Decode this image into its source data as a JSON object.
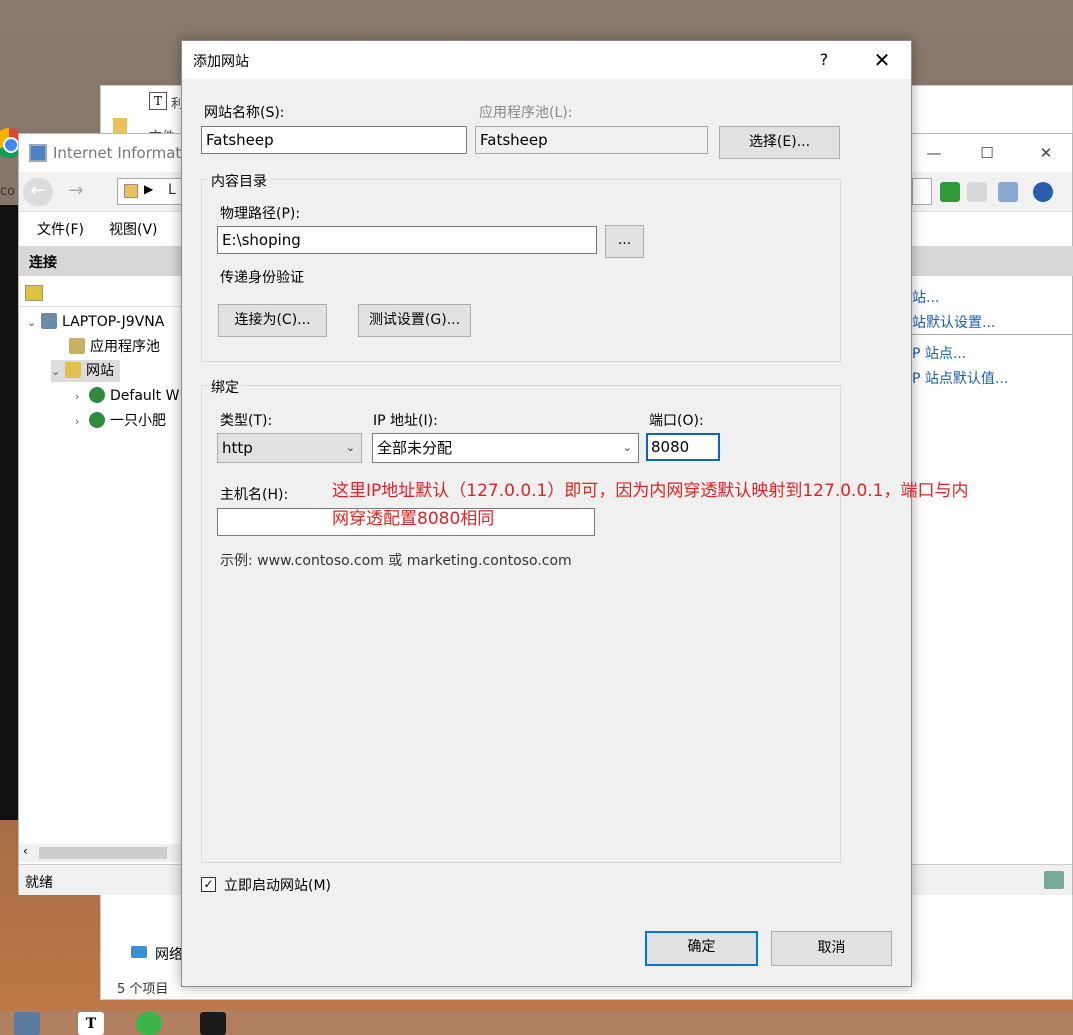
{
  "explorer": {
    "tab_label": "T",
    "tab_text": "利",
    "file_text": "文件",
    "network_label": "网络",
    "item_count": "5 个项目"
  },
  "left": {
    "partial_text": "co"
  },
  "iis": {
    "title": "Internet Informati",
    "address_text": "L",
    "minimize_glyph": "—",
    "maximize_glyph": "☐",
    "close_glyph": "✕",
    "back_glyph": "←",
    "forward_glyph": "→",
    "crumb_glyph": "▶",
    "menu": {
      "file": "文件(F)",
      "view": "视图(V)"
    },
    "connections_header": "连接",
    "tree": {
      "server": "LAPTOP-J9VNA",
      "app_pools": "应用程序池",
      "sites": "网站",
      "site1": "Default W",
      "site2": "一只小肥"
    },
    "actions": [
      "站...",
      "站默认设置...",
      "P 站点...",
      "P 站点默认值..."
    ],
    "status": "就绪"
  },
  "dialog": {
    "title": "添加网站",
    "help": "?",
    "close": "✕",
    "site_name_label": "网站名称(S):",
    "site_name_value": "Fatsheep",
    "app_pool_label": "应用程序池(L):",
    "app_pool_value": "Fatsheep",
    "select_button": "选择(E)...",
    "content_dir_title": "内容目录",
    "physical_path_label": "物理路径(P):",
    "physical_path_value": "E:\\shoping",
    "browse_button": "...",
    "pass_through_label": "传递身份验证",
    "connect_as_button": "连接为(C)...",
    "test_settings_button": "测试设置(G)...",
    "binding_title": "绑定",
    "type_label": "类型(T):",
    "type_value": "http",
    "ip_label": "IP 地址(I):",
    "ip_value": "全部未分配",
    "port_label": "端口(O):",
    "port_value": "8080",
    "hostname_label": "主机名(H):",
    "hostname_value": "",
    "example_text": "示例: www.contoso.com 或 marketing.contoso.com",
    "annotation_line1": "这里IP地址默认（127.0.0.1）即可，因为内网穿透默认映射到127.0.0.1，端口与内",
    "annotation_line2": "网穿透配置8080相同",
    "start_immediately_label": "立即启动网站(M)",
    "start_immediately_checked": "✓",
    "ok_button": "确定",
    "cancel_button": "取消"
  },
  "taskbar": {
    "t_app": "T"
  }
}
